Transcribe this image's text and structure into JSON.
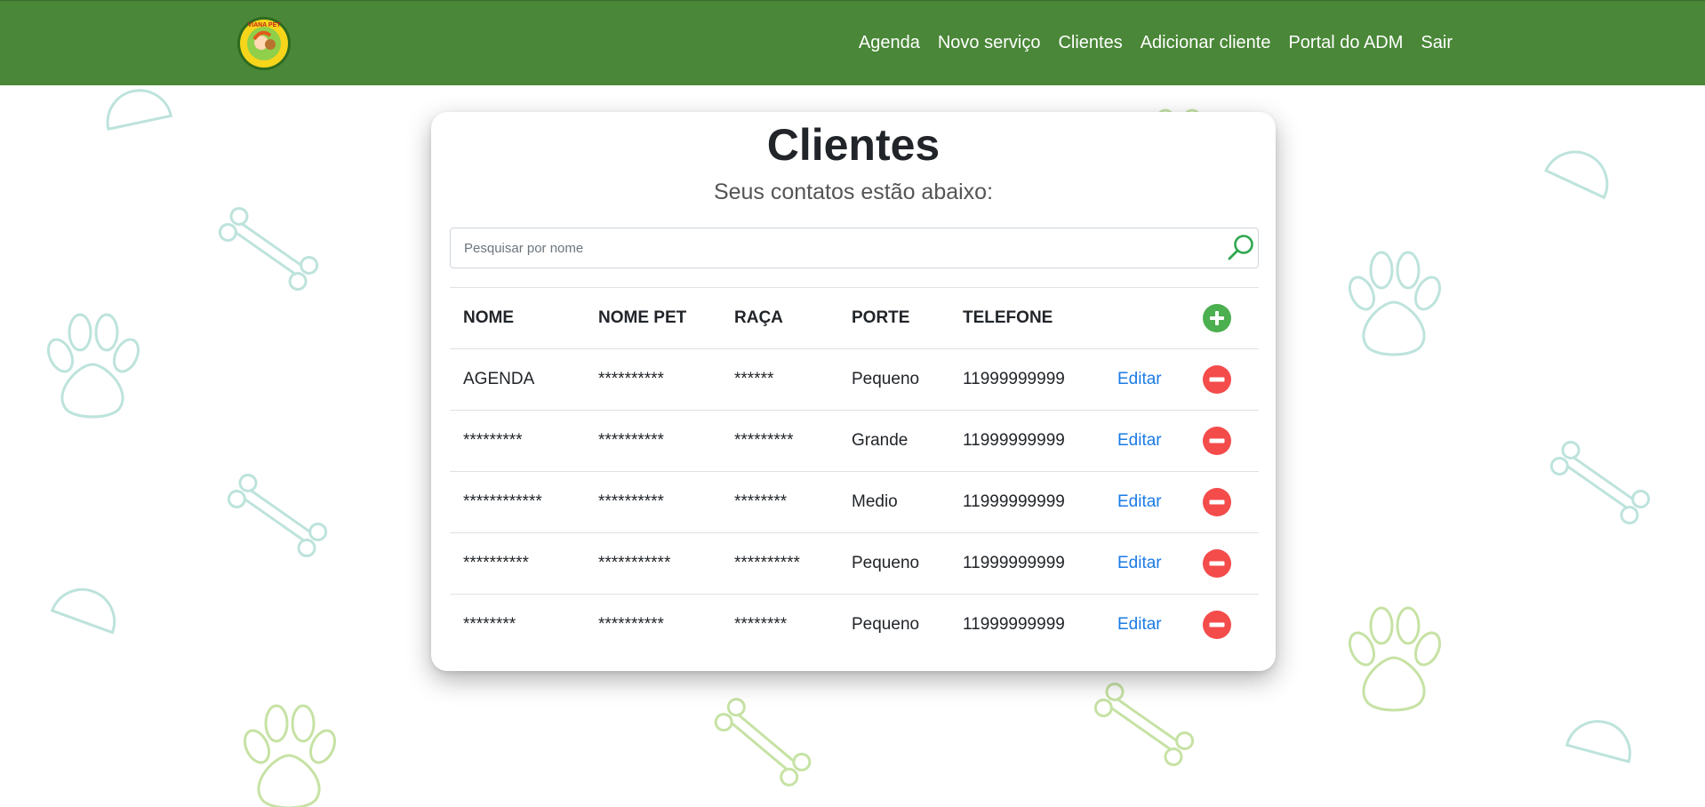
{
  "nav": {
    "logo_text": "VIANA PET",
    "links": [
      "Agenda",
      "Novo serviço",
      "Clientes",
      "Adicionar cliente",
      "Portal do ADM",
      "Sair"
    ]
  },
  "page": {
    "title": "Clientes",
    "subtitle": "Seus contatos estão abaixo:"
  },
  "search": {
    "placeholder": "Pesquisar por nome",
    "value": ""
  },
  "table": {
    "headers": [
      "NOME",
      "NOME PET",
      "RAÇA",
      "PORTE",
      "TELEFONE"
    ],
    "edit_label": "Editar",
    "rows": [
      [
        "AGENDA",
        "**********",
        "******",
        "Pequeno",
        "11999999999"
      ],
      [
        "*********",
        "**********",
        "*********",
        "Grande",
        "11999999999"
      ],
      [
        "************",
        "**********",
        "********",
        "Medio",
        "11999999999"
      ],
      [
        "**********",
        "***********",
        "**********",
        "Pequeno",
        "11999999999"
      ],
      [
        "********",
        "**********",
        "********",
        "Pequeno",
        "11999999999"
      ]
    ]
  },
  "icons": {
    "logo": "viana-pet-logo",
    "search": "search-icon",
    "add": "plus-circle-icon",
    "remove": "minus-circle-icon"
  },
  "colors": {
    "navbar": "#4a8738",
    "add_button": "#4caf50",
    "remove_button": "#f44b4b",
    "link": "#1a7be6",
    "search_icon": "#2fa84f"
  }
}
